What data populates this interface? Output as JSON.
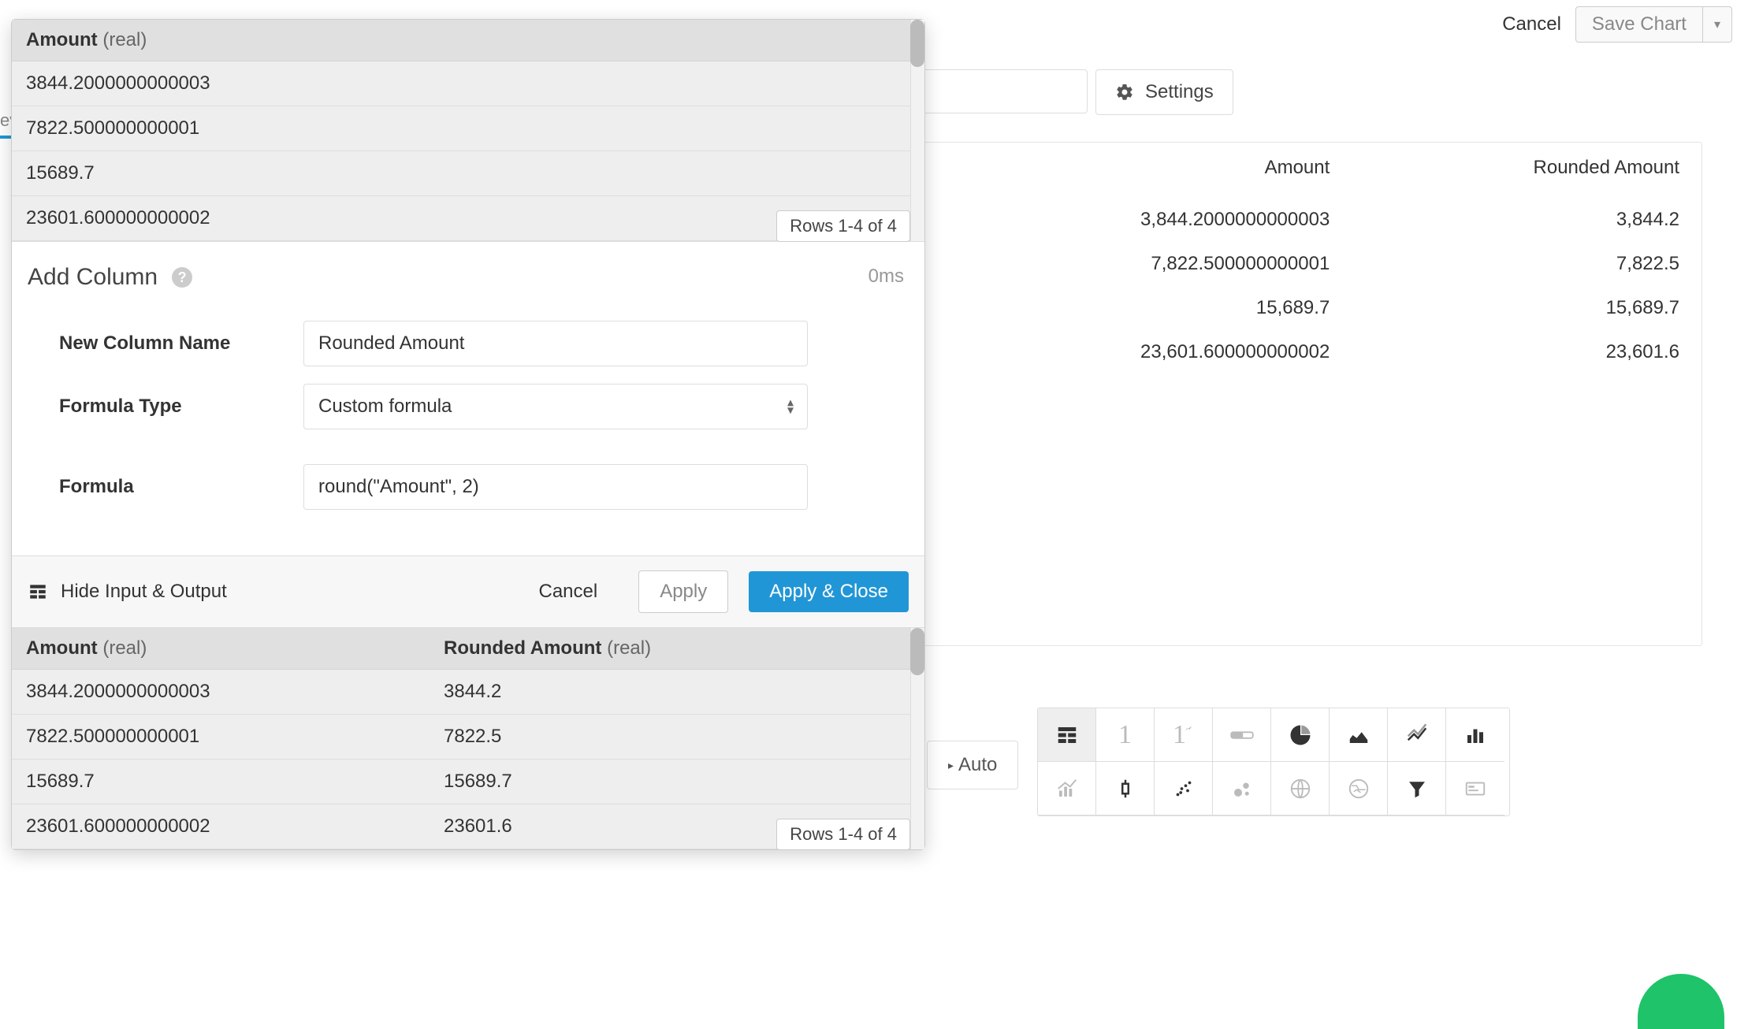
{
  "top": {
    "cancel": "Cancel",
    "save": "Save Chart"
  },
  "settings": "Settings",
  "ev_fragment": "ev",
  "auto_label": "Auto",
  "input_preview": {
    "header_name": "Amount",
    "header_type": "(real)",
    "rows": [
      "3844.2000000000003",
      "7822.500000000001",
      "15689.7",
      "23601.600000000002"
    ],
    "rows_badge": "Rows 1-4 of 4"
  },
  "form": {
    "title": "Add Column",
    "timing": "0ms",
    "new_col_label": "New Column Name",
    "new_col_value": "Rounded Amount",
    "type_label": "Formula Type",
    "type_value": "Custom formula",
    "formula_label": "Formula",
    "formula_value": "round(\"Amount\", 2)"
  },
  "actions": {
    "hide": "Hide Input & Output",
    "cancel": "Cancel",
    "apply": "Apply",
    "apply_close": "Apply & Close"
  },
  "output_preview": {
    "col1_name": "Amount",
    "col1_type": "(real)",
    "col2_name": "Rounded Amount",
    "col2_type": "(real)",
    "rows": [
      {
        "a": "3844.2000000000003",
        "b": "3844.2"
      },
      {
        "a": "7822.500000000001",
        "b": "7822.5"
      },
      {
        "a": "15689.7",
        "b": "15689.7"
      },
      {
        "a": "23601.600000000002",
        "b": "23601.6"
      }
    ],
    "rows_badge": "Rows 1-4 of 4"
  },
  "data_table": {
    "headers": [
      "Amount",
      "Rounded Amount"
    ],
    "rows": [
      [
        "3,844.2000000000003",
        "3,844.2"
      ],
      [
        "7,822.500000000001",
        "7,822.5"
      ],
      [
        "15,689.7",
        "15,689.7"
      ],
      [
        "23,601.600000000002",
        "23,601.6"
      ]
    ]
  }
}
